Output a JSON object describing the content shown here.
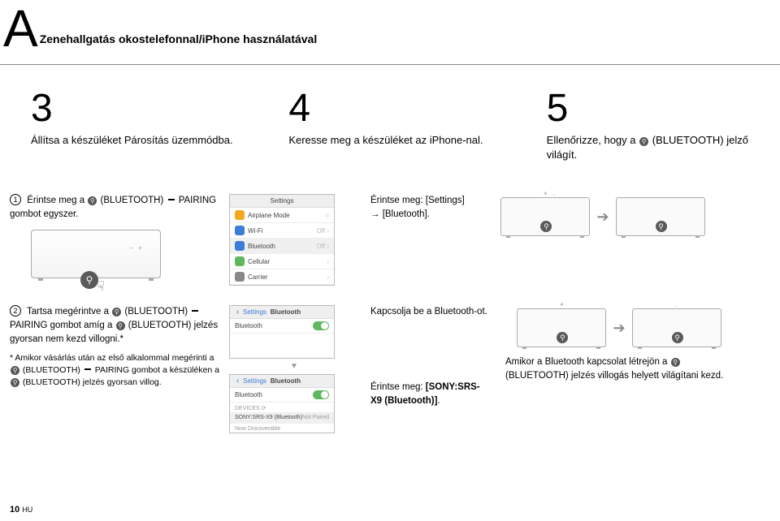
{
  "header": {
    "letter": "A",
    "title": "Zenehallgatás okostelefonnal/iPhone használatával"
  },
  "steps": {
    "s3": {
      "num": "3",
      "text": "Állítsa a készüléket Párosítás üzemmódba."
    },
    "s4": {
      "num": "4",
      "text": "Keresse meg a készüléket az iPhone-nal."
    },
    "s5": {
      "num": "5",
      "text_pre": "Ellenőrizze, hogy a ",
      "text_post": " (BLUETOOTH) jelző világít."
    }
  },
  "row2": {
    "circ": "1",
    "text_pre": "Érintse meg a ",
    "text_mid": " (BLUETOOTH) ",
    "text_post": " PAIRING gombot egyszer.",
    "mid_text": "Érintse meg: [Settings] → [Bluetooth].",
    "phone1": {
      "title": "Settings",
      "airplane": "Airplane Mode",
      "wifi": "Wi-Fi",
      "wifi_val": "Off",
      "bt": "Bluetooth",
      "bt_val": "Off",
      "cell": "Cellular",
      "carrier": "Carrier"
    }
  },
  "row3": {
    "circ": "2",
    "l1_pre": "Tartsa megérintve a ",
    "l1_mid1": " (BLUETOOTH) ",
    "l1_mid2": " PAIRING gombot amíg a ",
    "l1_post": " (BLUETOOTH) jelzés gyorsan nem kezd villogni.*",
    "note_pre": "* Amikor vásárlás után az első alkalommal megérinti a ",
    "note_mid1": " (BLUETOOTH) ",
    "note_mid2": " PAIRING gombot a készüléken a ",
    "note_post": " (BLUETOOTH) jelzés gyorsan villog.",
    "phone2": {
      "back": "Settings",
      "title": "Bluetooth",
      "bt_row": "Bluetooth"
    },
    "phone3": {
      "back": "Settings",
      "title": "Bluetooth",
      "bt_row": "Bluetooth",
      "devices_lbl": "DEVICES",
      "device_name": "SONY:SRS-X9 (Bluetooth)",
      "device_status": "Not Paired",
      "discover": "Now Discoverable"
    },
    "mid_text1": "Kapcsolja be a Bluetooth-ot.",
    "mid_text2": "Érintse meg: [SONY:SRS-X9 (Bluetooth)].",
    "right_pre": "Amikor a Bluetooth kapcsolat létrejön a ",
    "right_post": " (BLUETOOTH) jelzés villogás helyett világítani kezd."
  },
  "footer": {
    "page": "10",
    "lang": "HU"
  }
}
